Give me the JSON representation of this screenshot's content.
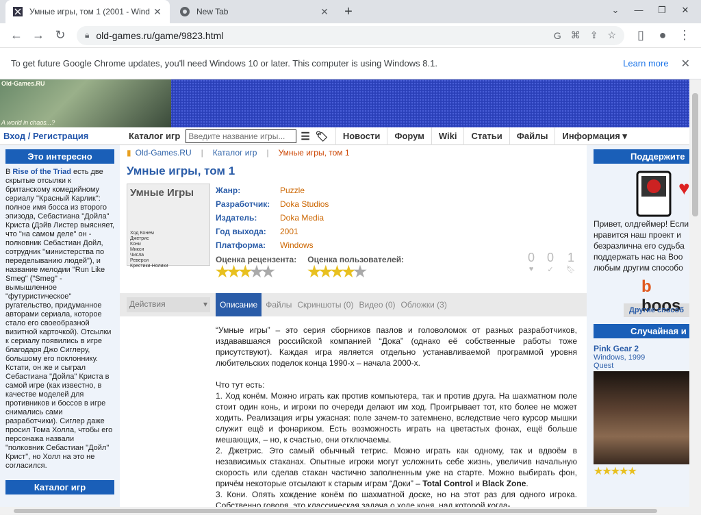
{
  "browser": {
    "active_tab_title": "Умные игры, том 1 (2001 - Wind",
    "inactive_tab_title": "New Tab",
    "url": "old-games.ru/game/9823.html",
    "infobar_text": "To get future Google Chrome updates, you'll need Windows 10 or later. This computer is using Windows 8.1.",
    "infobar_link": "Learn more"
  },
  "site": {
    "logo_text": "Old-Games.RU",
    "logo_tagline": "A world in chaos...?",
    "login": "Вход / Регистрация",
    "catalog": "Каталог игр",
    "search_placeholder": "Введите название игры...",
    "menu": [
      "Новости",
      "Форум",
      "Wiki",
      "Статьи",
      "Файлы",
      "Информация ▾"
    ]
  },
  "left": {
    "head": "Это интересно",
    "text_pre": "В ",
    "text_link": "Rise of the Triad",
    "text_post": " есть две скрытые отсылки к британскому комедийному сериалу \"Красный Карлик\": полное имя босса из второго эпизода, Себастиана \"Дойла\" Криста (Дэйв Листер выясняет, что \"на самом деле\" он - полковник Себастиан Дойл, сотрудник \"министерства по переделыванию людей\"), и название мелодии \"Run Like Smeg\" (\"Smeg\" - вымышленное \"футуристическое\" ругательство, придуманное авторами сериала, которое стало его своеобразной визитной карточкой). Отсылки к сериалу появились в игре благодаря Джо Сиглеру, большому его поклоннику. Кстати, он же и сыграл Себастиана \"Дойла\" Криста в самой игре (как известно, в качестве моделей для противников и боссов в игре снимались сами разработчики). Сиглер даже просил Тома Холла, чтобы его персонажа назвали \"полковник Себастиан \"Дойл\" Крист\", но Холл на это не согласился.",
    "catalog_head": "Каталог игр"
  },
  "breadcrumb": [
    "Old-Games.RU",
    "Каталог игр",
    "Умные игры, том 1"
  ],
  "game": {
    "title": "Умные игры, том 1",
    "cover_title": "Умные Игры",
    "cover_list": [
      "Ход Конем",
      "Джетрис",
      "Кони",
      "Микси",
      "Числа",
      "Реверси",
      "Крестики-Нолики"
    ],
    "fields": [
      {
        "k": "Жанр:",
        "v": "Puzzle"
      },
      {
        "k": "Разработчик:",
        "v": "Doka Studios"
      },
      {
        "k": "Издатель:",
        "v": "Doka Media"
      },
      {
        "k": "Год выхода:",
        "v": "2001"
      },
      {
        "k": "Платформа:",
        "v": "Windows"
      }
    ],
    "review_label": "Оценка рецензента:",
    "review_stars": 3,
    "user_label": "Оценка пользователей:",
    "user_stars": 4,
    "counts": [
      "0",
      "0",
      "1"
    ]
  },
  "tabs": {
    "actions": "Действия",
    "items": [
      "Описание",
      "Файлы",
      "Скриншоты (0)",
      "Видео (0)",
      "Обложки (3)"
    ]
  },
  "description": {
    "p1": "“Умные игры” – это серия сборников пазлов и головоломок от разных разработчиков, издававшаяся российской компанией “Дока” (однако её собственные работы тоже присутствуют). Каждая игра является отдельно устанавливаемой программой уровня любительских поделок конца 1990-х – начала 2000-х.",
    "p2": "Что тут есть:",
    "p3": "1. Ход конём. Можно играть как против компьютера, так и против друга. На шахматном поле стоит один конь, и игроки по очереди делают им ход. Проигрывает тот, кто более не может ходить. Реализация игры ужасная: поле зачем-то затемнено, вследствие чего курсор мышки служит ещё и фонариком. Есть возможность играть на цветастых фонах, ещё больше мешающих, – но, к счастью, они отключаемы.",
    "p4": "2. Джетрис. Это самый обычный тетрис. Можно играть как одному, так и вдвоём в независимых стаканах. Опытные игроки могут усложнить себе жизнь, увеличив начальную скорость или сделав стакан частично заполненным уже на старте. Можно выбирать фон, причём некоторые отсылают к старым играм “Доки” – ",
    "p4b1": "Total Control",
    "p4mid": " и ",
    "p4b2": "Black Zone",
    "p5": "3. Кони. Опять хождение конём по шахматной доске, но на этот раз для одного игрока. Собственно говоря, это классическая задача о ходе коня, над которой когда-"
  },
  "right": {
    "support_head": "Поддержите",
    "support_text": "Привет, олдгеймер! Если нравится наш проект и безразлична его судьба поддержать нас на Boo любым другим способо",
    "other_ways": "Другие способ",
    "random_head": "Случайная и",
    "random_title": "Pink Gear 2",
    "random_meta": "Windows, 1999",
    "random_genre": "Quest"
  }
}
